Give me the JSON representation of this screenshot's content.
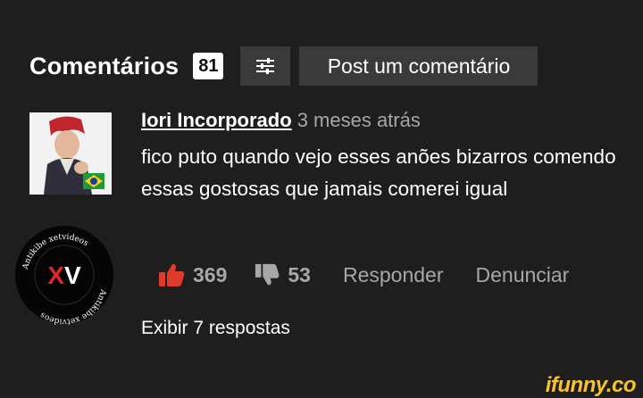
{
  "header": {
    "title": "Comentários",
    "count": "81",
    "filter_icon": "sliders-icon",
    "post_label": "Post um comentário"
  },
  "comment": {
    "author": "Iori Incorporado",
    "time": "3 meses atrás",
    "text": "fico puto quando vejo esses anões bizarros comendo essas gostosas que jamais comerei igual",
    "likes": "369",
    "dislikes": "53",
    "reply_label": "Responder",
    "report_label": "Denunciar",
    "show_replies": "Exibir 7 respostas"
  },
  "watermark": {
    "logo_text": "XV",
    "ring_text": "Antikibe xetvideos"
  },
  "footer": {
    "brand": "ifunny.co"
  },
  "colors": {
    "background": "#1f1e1f",
    "button_bg": "#3a3a3b",
    "muted_text": "#a7a7a8",
    "like_red": "#e03a2d",
    "brand_yellow": "#f7c330"
  }
}
